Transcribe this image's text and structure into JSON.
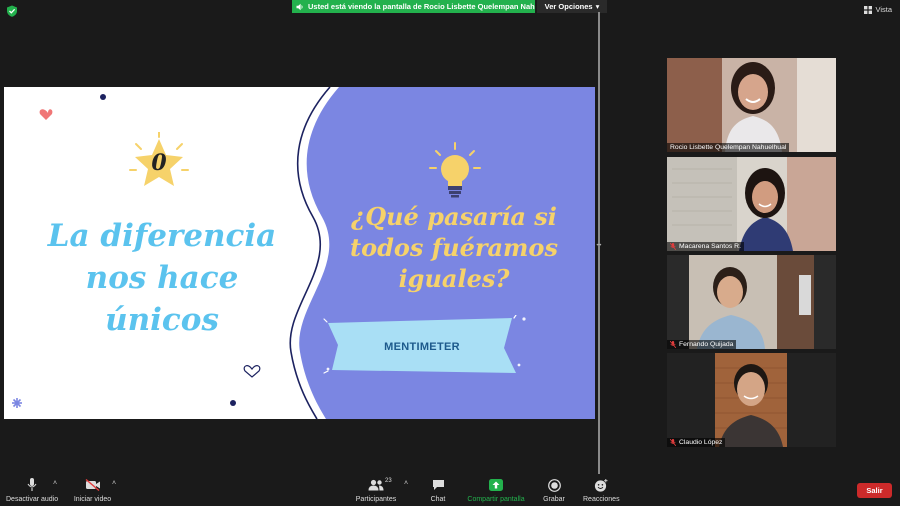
{
  "top_bar": {
    "share_banner": "Usted está viendo la pantalla de Rocio Lisbette Quelempan Nahue...",
    "view_options": "Ver Opciones",
    "vista": "Vista"
  },
  "slide": {
    "left_title_lines": [
      "La diferencia",
      "nos hace",
      "únicos"
    ],
    "star_number": "0",
    "question_lines": [
      "¿Qué pasaría si",
      "todos fuéramos",
      "iguales?"
    ],
    "banner_text": "MENTIMETER"
  },
  "participants": [
    {
      "name": "Rocio Lisbette Quelempan Nahuelhual",
      "muted": false
    },
    {
      "name": "Macarena Santos R.",
      "muted": true
    },
    {
      "name": "Fernando Quijada",
      "muted": true
    },
    {
      "name": "Claudio López",
      "muted": true
    }
  ],
  "toolbar": {
    "audio_label": "Desactivar audio",
    "video_label": "Iniciar video",
    "participants_label": "Participantes",
    "participants_count": "23",
    "chat_label": "Chat",
    "share_label": "Compartir pantalla",
    "record_label": "Grabar",
    "reactions_label": "Reacciones",
    "exit_label": "Salir"
  },
  "colors": {
    "share_green": "#23b14d",
    "slide_purple": "#7b86e2",
    "title_blue": "#5bc3ee",
    "question_yellow": "#f6d26a",
    "exit_red": "#cc2a2a"
  }
}
